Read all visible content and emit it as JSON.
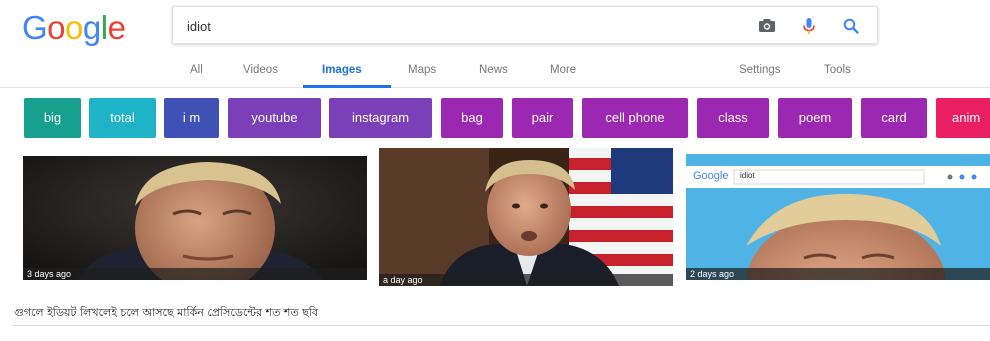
{
  "logo": {
    "letters": [
      "G",
      "o",
      "o",
      "g",
      "l",
      "e"
    ],
    "colors": [
      "#4285F4",
      "#EA4335",
      "#FBBC05",
      "#4285F4",
      "#34A853",
      "#EA4335"
    ]
  },
  "search": {
    "value": "idiot",
    "icons": [
      "camera-icon",
      "microphone-icon",
      "search-icon"
    ]
  },
  "tabs": [
    {
      "label": "All"
    },
    {
      "label": "Videos"
    },
    {
      "label": "Images",
      "active": true
    },
    {
      "label": "Maps"
    },
    {
      "label": "News"
    },
    {
      "label": "More"
    },
    {
      "label": "Settings"
    },
    {
      "label": "Tools"
    }
  ],
  "chips": [
    {
      "label": "big",
      "color": "#17a08e"
    },
    {
      "label": "total",
      "color": "#1fb3c8"
    },
    {
      "label": "i m",
      "color": "#3f51b5"
    },
    {
      "label": "youtube",
      "color": "#7b3fb8"
    },
    {
      "label": "instagram",
      "color": "#7b3fb8"
    },
    {
      "label": "bag",
      "color": "#9c27b0"
    },
    {
      "label": "pair",
      "color": "#9c27b0"
    },
    {
      "label": "cell phone",
      "color": "#9c27b0"
    },
    {
      "label": "class",
      "color": "#9c27b0"
    },
    {
      "label": "poem",
      "color": "#9c27b0"
    },
    {
      "label": "card",
      "color": "#9c27b0"
    },
    {
      "label": "anim",
      "color": "#e91e63"
    }
  ],
  "results": [
    {
      "age": "3 days ago"
    },
    {
      "age": "a day ago"
    },
    {
      "age": "2 days ago",
      "inner_logo": "Google",
      "inner_query": "idiot"
    }
  ],
  "caption": "গুগলে ইডিয়ট লিখলেই চলে আসছে মার্কিন প্রেসিডেন্টের শত শত ছবি"
}
